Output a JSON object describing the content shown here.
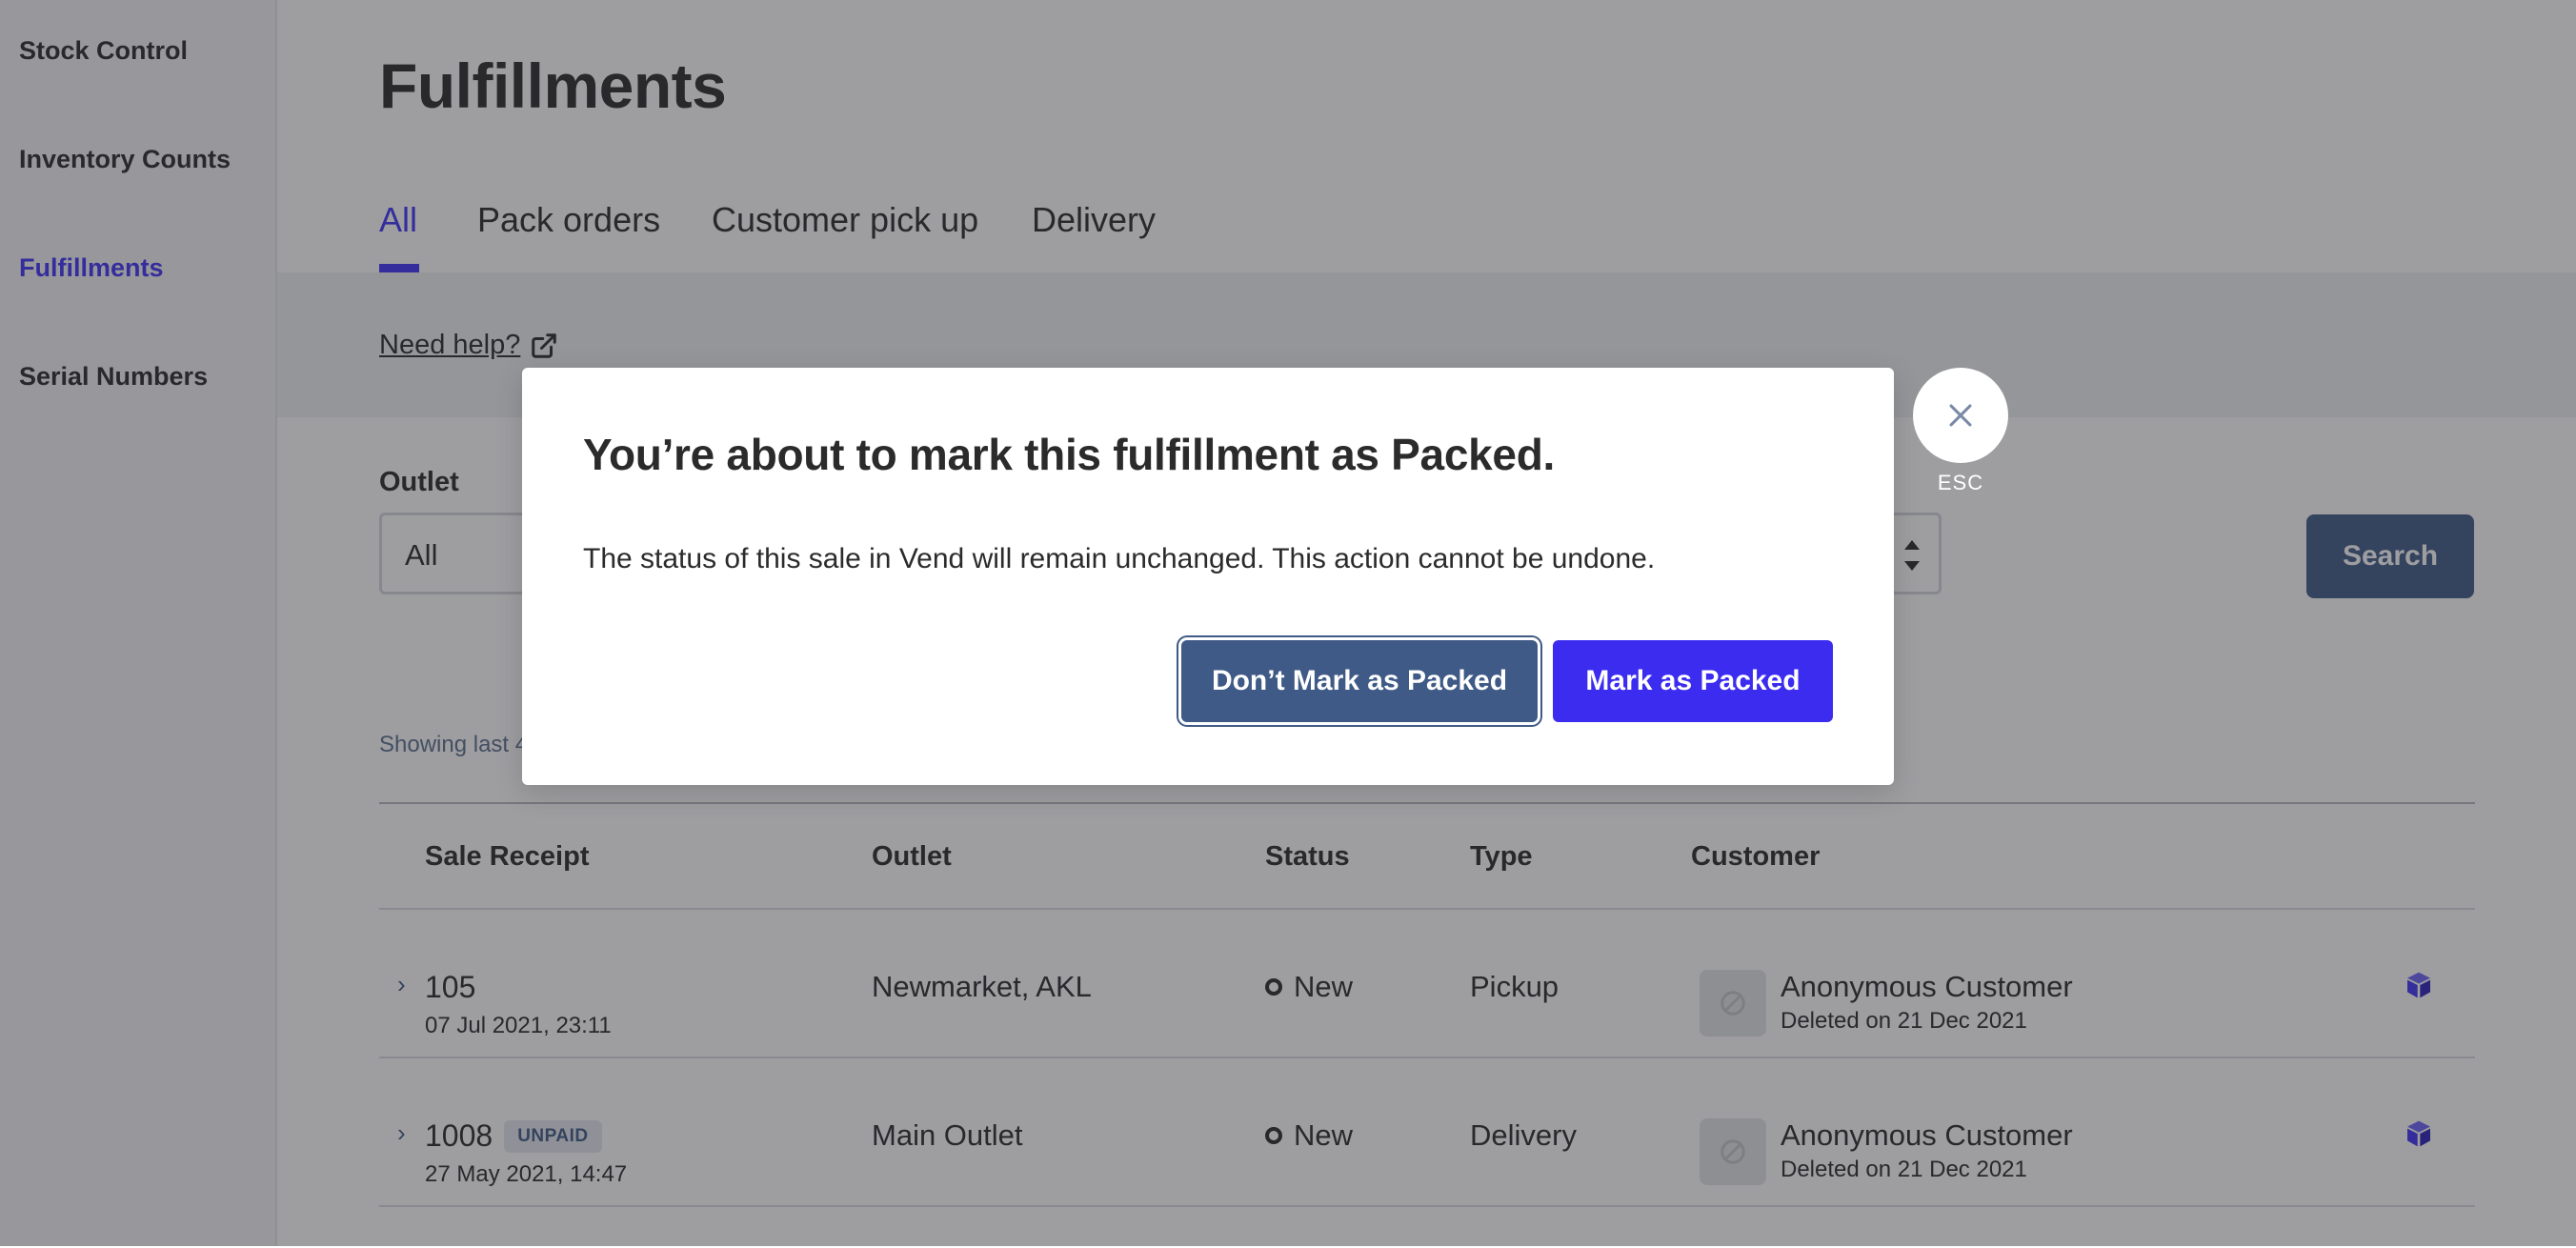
{
  "sidebar": {
    "items": [
      {
        "label": "Stock Control"
      },
      {
        "label": "Inventory Counts"
      },
      {
        "label": "Fulfillments"
      },
      {
        "label": "Serial Numbers"
      }
    ]
  },
  "page": {
    "title": "Fulfillments"
  },
  "tabs": [
    {
      "label": "All"
    },
    {
      "label": "Pack orders"
    },
    {
      "label": "Customer pick up"
    },
    {
      "label": "Delivery"
    }
  ],
  "help": {
    "label": "Need help?"
  },
  "filters": {
    "outlet_label": "Outlet",
    "outlet_value": "All",
    "search_label": "Search"
  },
  "results": {
    "showing_text": "Showing last 4"
  },
  "table": {
    "headers": {
      "receipt": "Sale Receipt",
      "outlet": "Outlet",
      "status": "Status",
      "type": "Type",
      "customer": "Customer"
    },
    "rows": [
      {
        "receipt": "105",
        "badge": "",
        "date": "07 Jul 2021, 23:11",
        "outlet": "Newmarket, AKL",
        "status": "New",
        "type": "Pickup",
        "customer": "Anonymous Customer",
        "customer_note": "Deleted on 21 Dec 2021"
      },
      {
        "receipt": "1008",
        "badge": "UNPAID",
        "date": "27 May 2021, 14:47",
        "outlet": "Main Outlet",
        "status": "New",
        "type": "Delivery",
        "customer": "Anonymous Customer",
        "customer_note": "Deleted on 21 Dec 2021"
      }
    ]
  },
  "modal": {
    "title": "You’re about to mark this fulfillment as Packed.",
    "body": "The status of this sale in Vend will remain unchanged. This action cannot be undone.",
    "cancel_label": "Don’t Mark as Packed",
    "confirm_label": "Mark as Packed",
    "close_hint": "ESC"
  },
  "colors": {
    "accent": "#3f32f5",
    "primary_button": "#3b2cef",
    "secondary_button": "#3f5a86"
  },
  "icons": {
    "help": "external-link-icon",
    "close": "close-icon",
    "row_action": "box-icon",
    "avatar": "blocked-avatar-icon",
    "expand": "chevron-right-icon"
  }
}
